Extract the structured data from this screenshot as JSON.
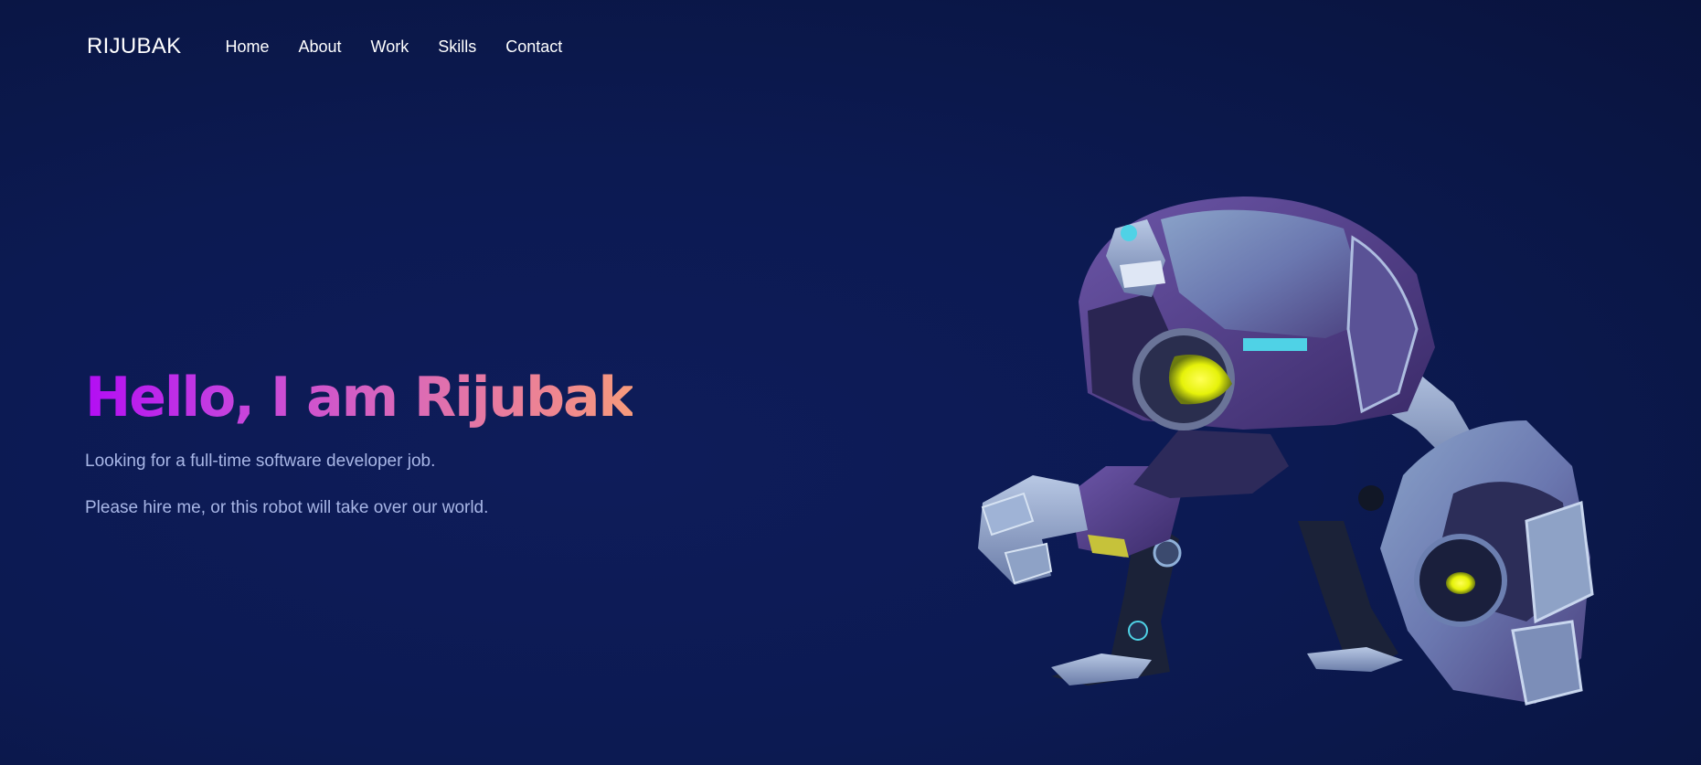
{
  "nav": {
    "logo": "RIJUBAK",
    "items": [
      {
        "label": "Home"
      },
      {
        "label": "About"
      },
      {
        "label": "Work"
      },
      {
        "label": "Skills"
      },
      {
        "label": "Contact"
      }
    ]
  },
  "hero": {
    "title": "Hello, I am Rijubak",
    "line1": "Looking for a full-time software developer job.",
    "line2": "Please hire me, or this robot will take over our world."
  },
  "colors": {
    "background": "#0c1a52",
    "gradient_start": "#b30df4",
    "gradient_end": "#f79b7c",
    "subtitle": "#a8b6e6",
    "robot_eye": "#e6f20a"
  },
  "icons": {
    "hero_image": "robot-illustration"
  }
}
